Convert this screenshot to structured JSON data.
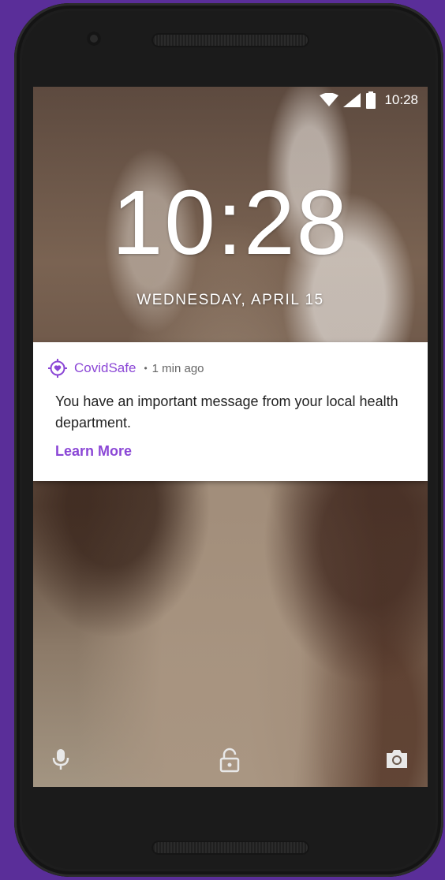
{
  "status_bar": {
    "time": "10:28",
    "icons": [
      "wifi-icon",
      "signal-icon",
      "battery-icon"
    ]
  },
  "lock_screen": {
    "clock": "10:28",
    "date": "WEDNESDAY, APRIL 15"
  },
  "notification": {
    "app_icon": "covidsafe-heart-target-icon",
    "app_name": "CovidSafe",
    "separator": "•",
    "time_ago": "1 min ago",
    "body": "You have an important message from your local health department.",
    "action_label": "Learn More"
  },
  "bottom_actions": {
    "icons": [
      "microphone-icon",
      "unlock-icon",
      "camera-icon"
    ]
  },
  "colors": {
    "accent": "#8b47d6",
    "background": "#5a2e99",
    "phone_body": "#1d1d1d"
  }
}
